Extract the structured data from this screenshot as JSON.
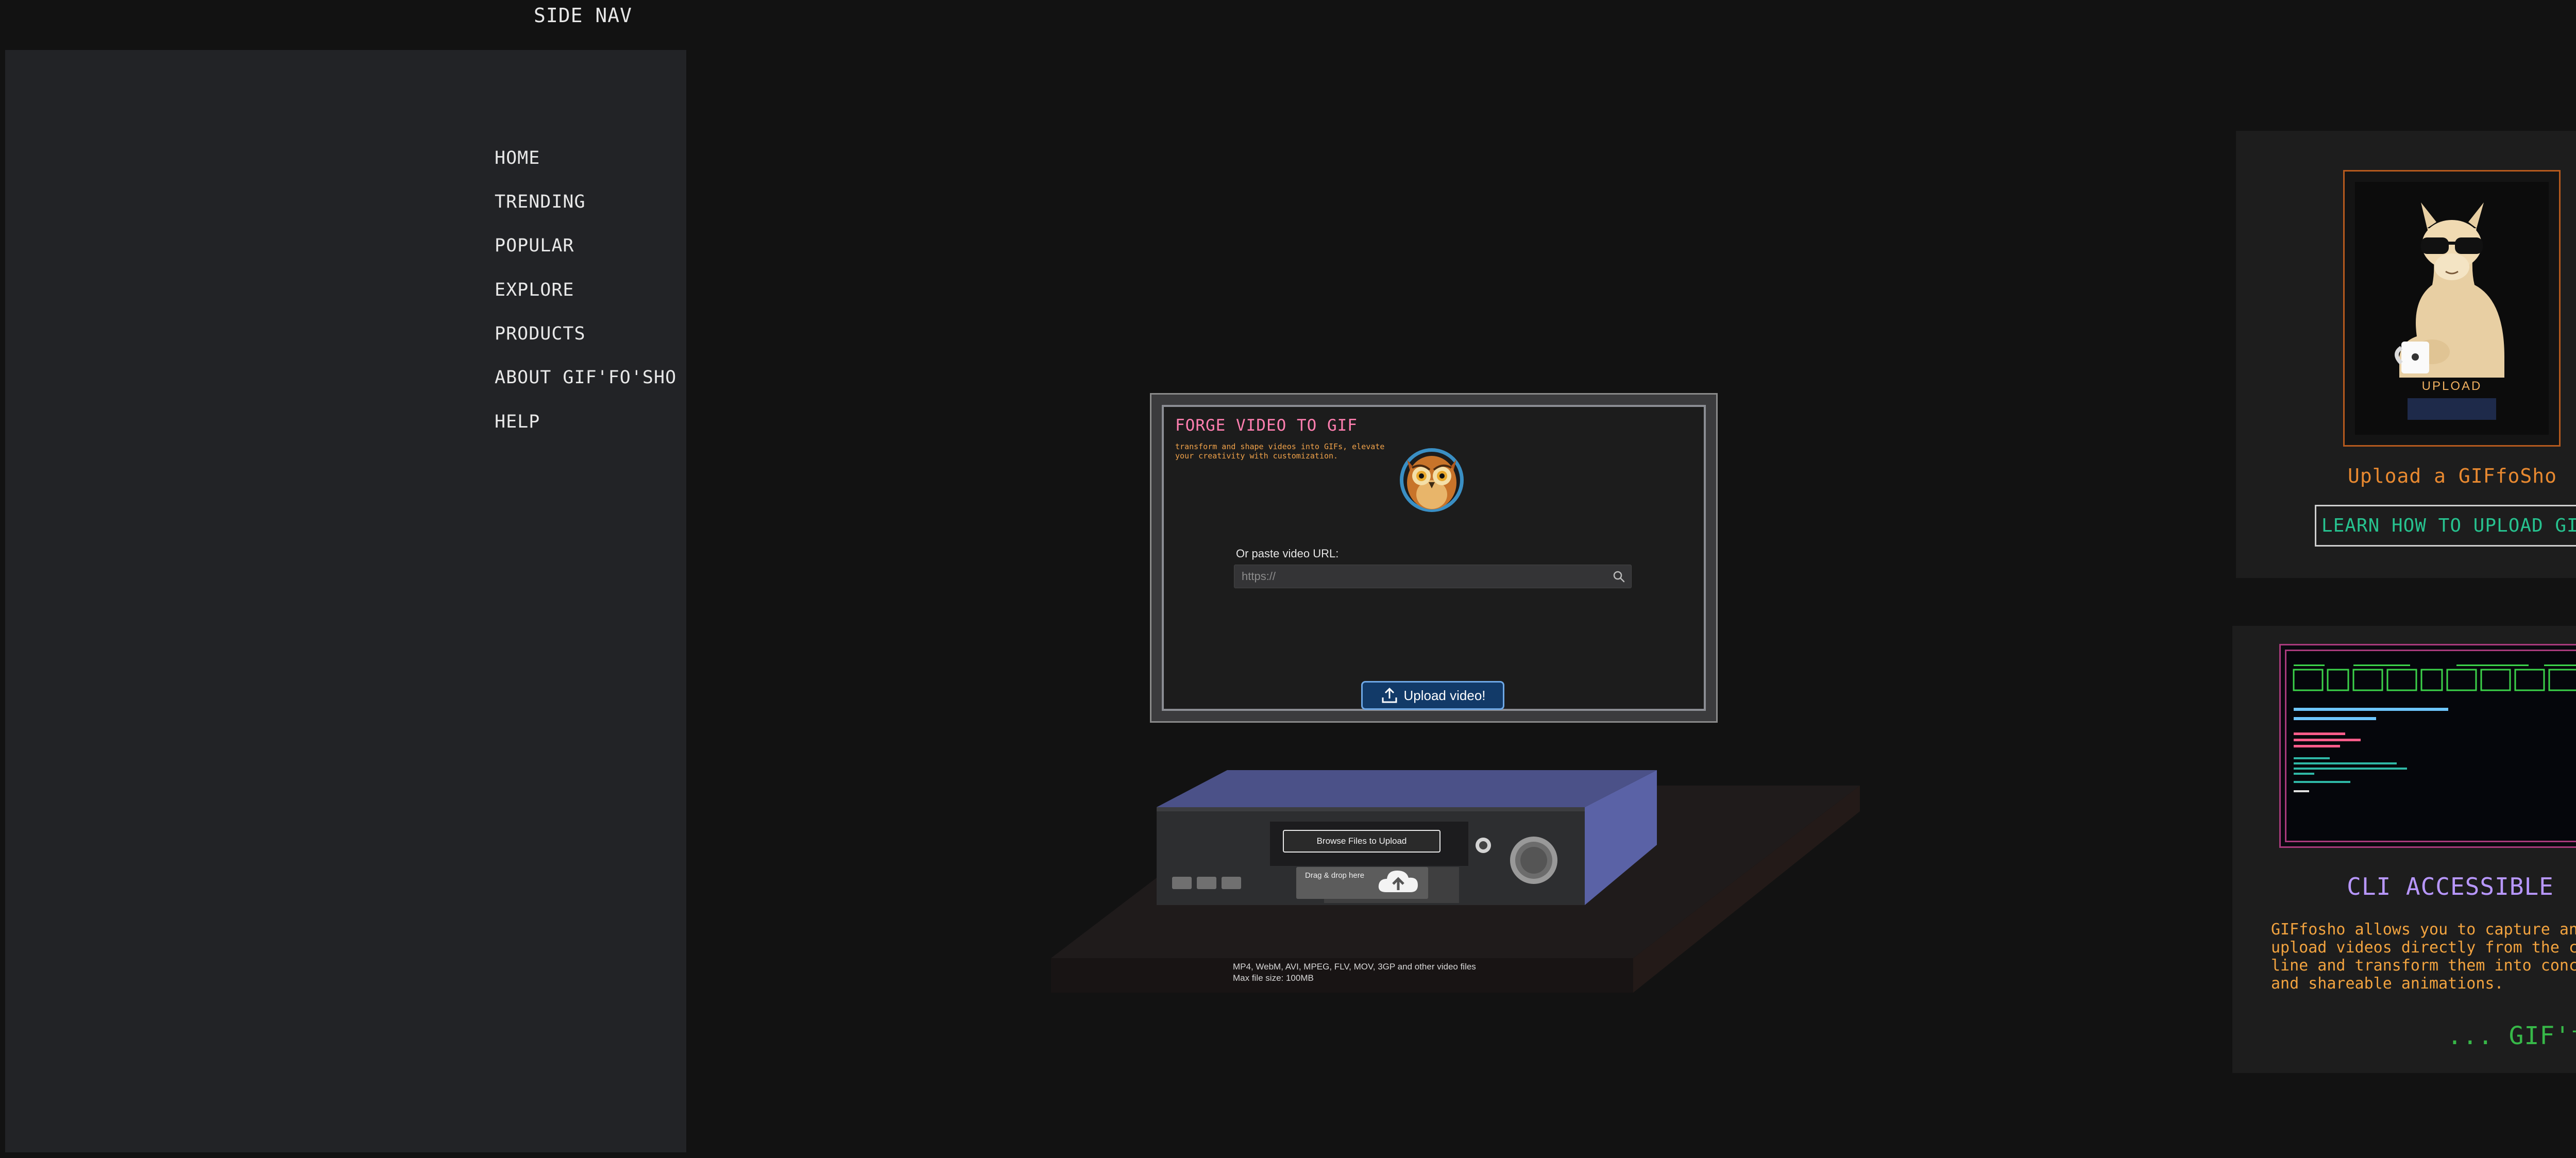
{
  "sidenav": {
    "title": "SIDE NAV",
    "items": [
      {
        "label": "HOME"
      },
      {
        "label": "TRENDING"
      },
      {
        "label": "POPULAR"
      },
      {
        "label": "EXPLORE"
      },
      {
        "label": "PRODUCTS"
      },
      {
        "label": "ABOUT GIF'FO'SHO"
      },
      {
        "label": "HELP"
      }
    ]
  },
  "forge": {
    "title": "FORGE VIDEO TO GIF",
    "description": "transform and shape videos into GIFs, elevate your creativity with customization.",
    "owl_icon": "owl-mascot-icon",
    "url_label": "Or paste video URL:",
    "url_placeholder": "https://",
    "url_value": "",
    "upload_button": "Upload video!"
  },
  "dropzone": {
    "browse_button": "Browse Files to Upload",
    "drop_text": "Drag & drop here",
    "formats": "MP4, WebM, AVI, MPEG, FLV, MOV, 3GP and other video files",
    "max_size": "Max file size: 100MB"
  },
  "upload_card": {
    "image_caption": "UPLOAD",
    "title": "Upload a GIFfoSho",
    "button": "LEARN HOW TO UPLOAD GIFS"
  },
  "cli_card": {
    "title": "CLI ACCESSIBLE",
    "description": "GIFfosho allows you to capture and upload videos directly from the command line and transform them into concise and shareable animations.",
    "tagline": "... GIF'fo'Sho!"
  },
  "colors": {
    "background": "#121212",
    "sidenav_panel": "#222326",
    "forge_title": "#ff7fb0",
    "accent_orange": "#e88930",
    "accent_green": "#27c28f",
    "cli_title": "#b897ff",
    "tagline": "#37b848",
    "upload_button": "#123a68"
  }
}
